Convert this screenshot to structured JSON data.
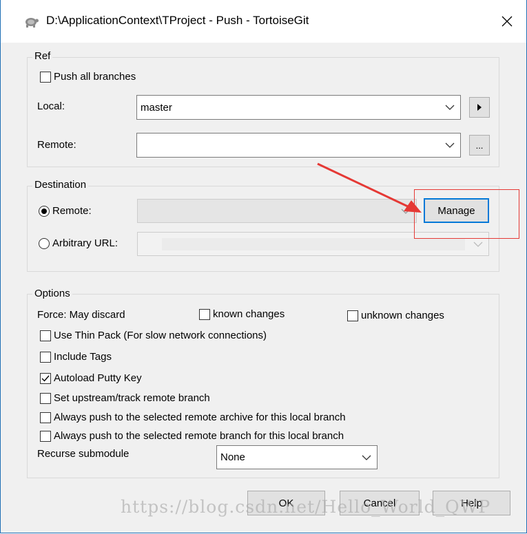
{
  "window": {
    "title": "D:\\ApplicationContext\\TProject - Push - TortoiseGit"
  },
  "ref": {
    "label": "Ref",
    "push_all_branches": {
      "label": "Push all branches",
      "checked": false
    },
    "local": {
      "label": "Local:",
      "value": "master"
    },
    "remote": {
      "label": "Remote:",
      "value": ""
    },
    "local_button": "▸",
    "remote_button": "..."
  },
  "destination": {
    "label": "Destination",
    "remote": {
      "label": "Remote:",
      "selected": true,
      "value": ""
    },
    "manage_button": "Manage",
    "arbitrary_url": {
      "label": "Arbitrary URL:",
      "selected": false,
      "value": ""
    }
  },
  "options": {
    "label": "Options",
    "force_label": "Force: May discard",
    "known_changes": {
      "label": "known changes",
      "checked": false
    },
    "unknown_changes": {
      "label": "unknown changes",
      "checked": false
    },
    "use_thin_pack": {
      "label": "Use Thin Pack (For slow network connections)",
      "checked": false
    },
    "include_tags": {
      "label": "Include Tags",
      "checked": false
    },
    "autoload_putty_key": {
      "label": "Autoload Putty Key",
      "checked": true
    },
    "set_upstream": {
      "label": "Set upstream/track remote branch",
      "checked": false
    },
    "always_push_archive": {
      "label": "Always push to the selected remote archive for this local branch",
      "checked": false
    },
    "always_push_branch": {
      "label": "Always push to the selected remote branch for this local branch",
      "checked": false
    },
    "recurse_submodule": {
      "label": "Recurse submodule",
      "value": "None"
    }
  },
  "footer": {
    "ok": "OK",
    "cancel": "Cancel",
    "help": "Help"
  },
  "watermark": "https://blog.csdn.net/Hello_World_QWP",
  "colors": {
    "accent": "#0078d7",
    "annotation": "#e53935",
    "dialog_bg": "#f0f0f0"
  }
}
